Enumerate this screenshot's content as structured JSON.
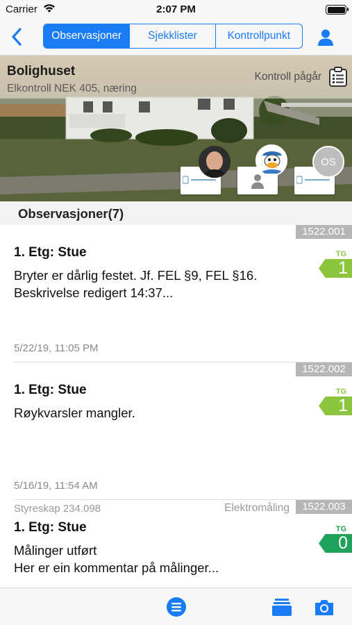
{
  "status_bar": {
    "carrier": "Carrier",
    "time": "2:07 PM"
  },
  "nav": {
    "back_icon": "chevron-left-icon",
    "tabs": [
      {
        "label": "Observasjoner",
        "active": true
      },
      {
        "label": "Sjekklister",
        "active": false
      },
      {
        "label": "Kontrollpunkt",
        "active": false
      }
    ],
    "user_icon": "person-icon"
  },
  "hero": {
    "title": "Bolighuset",
    "subtitle": "Elkontroll NEK 405, næring",
    "status": "Kontroll pågår",
    "avatar_initials": "OS"
  },
  "section": {
    "title": "Observasjoner(7)"
  },
  "observations": [
    {
      "id": "1522.001",
      "location": "1. Etg: Stue",
      "text": "Bryter er dårlig festet. Jf. FEL §9, FEL §16.\nBeskrivelse redigert 14:37...",
      "date": "5/22/19, 11:05 PM",
      "tg_label": "TG",
      "tg_value": "1"
    },
    {
      "id": "1522.002",
      "location": "1. Etg: Stue",
      "text": "Røykvarsler mangler.",
      "date": "5/16/19, 11:54 AM",
      "tg_label": "TG",
      "tg_value": "1"
    },
    {
      "id": "1522.003",
      "meta_left": "Styreskap 234.098",
      "meta_right": "Elektromåling",
      "location": "1. Etg: Stue",
      "text": "Målinger utført\nHer er ein kommentar på målinger...",
      "tg_label": "TG",
      "tg_value": "0"
    }
  ],
  "colors": {
    "accent": "#1a7cf4",
    "tg1": "#8cc63f",
    "tg0": "#1fa35a",
    "id_badge": "#b6b6b6"
  },
  "toolbar": {
    "items": [
      "list-icon",
      "folders-icon",
      "camera-icon"
    ]
  }
}
